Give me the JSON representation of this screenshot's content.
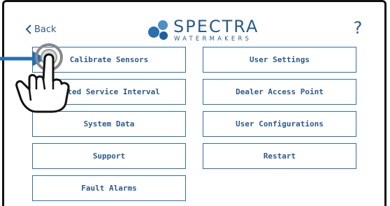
{
  "header": {
    "back_label": "Back",
    "logo_name": "SPECTRA",
    "logo_sub": "WATERMAKERS",
    "help_label": "?"
  },
  "menu": {
    "left": [
      {
        "label": "Calibrate Sensors"
      },
      {
        "label": "mated Service Interval"
      },
      {
        "label": "System Data"
      },
      {
        "label": "Support"
      },
      {
        "label": "Fault Alarms"
      }
    ],
    "right": [
      {
        "label": "User Settings"
      },
      {
        "label": "Dealer Access Point"
      },
      {
        "label": "User Configurations"
      },
      {
        "label": "Restart"
      }
    ]
  },
  "colors": {
    "accent": "#2a5b8c",
    "border": "#2a6fb0",
    "pointer_arrow": "#1f6fb5"
  },
  "icons": {
    "pointer": "arrow-right-icon",
    "tap": "tapping-hand-icon",
    "logo": "water-droplets-icon"
  }
}
